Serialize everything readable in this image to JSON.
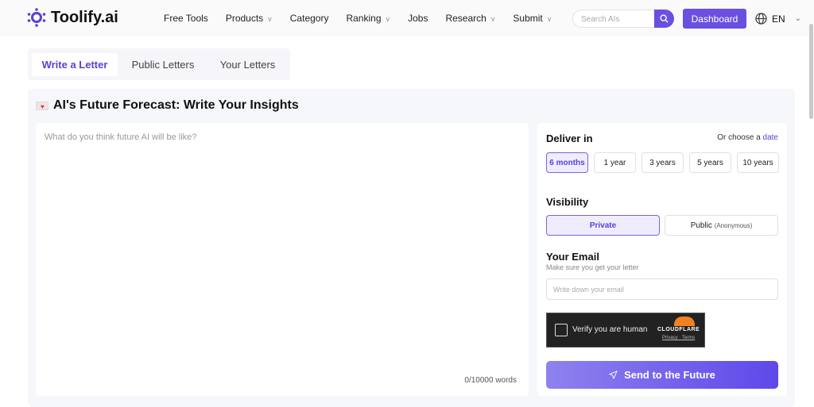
{
  "brand": {
    "name": "Toolify.ai",
    "accent": "#6b4fe0"
  },
  "nav": {
    "items": [
      {
        "label": "Free Tools",
        "dropdown": false
      },
      {
        "label": "Products",
        "dropdown": true
      },
      {
        "label": "Category",
        "dropdown": false
      },
      {
        "label": "Ranking",
        "dropdown": true
      },
      {
        "label": "Jobs",
        "dropdown": false
      },
      {
        "label": "Research",
        "dropdown": true
      },
      {
        "label": "Submit",
        "dropdown": true
      }
    ],
    "search_placeholder": "Search AIs",
    "dashboard": "Dashboard",
    "lang": "EN"
  },
  "tabs": [
    "Write a Letter",
    "Public Letters",
    "Your Letters"
  ],
  "title": "AI's Future Forecast: Write Your Insights",
  "editor": {
    "placeholder": "What do you think future AI will be like?",
    "count": "0/10000 words"
  },
  "deliver": {
    "label": "Deliver in",
    "alt_prefix": "Or choose a",
    "alt_link": "date",
    "options": [
      "6 months",
      "1 year",
      "3 years",
      "5 years",
      "10 years"
    ],
    "selected": 0
  },
  "visibility": {
    "label": "Visibility",
    "private": "Private",
    "public": "Public",
    "public_note": "(Anonymous)"
  },
  "email": {
    "label": "Your Email",
    "hint": "Make sure you get your letter",
    "placeholder": "Write down your email"
  },
  "captcha": {
    "label": "Verify you are human",
    "brand": "CLOUDFLARE",
    "privacy": "Privacy",
    "terms": "Terms"
  },
  "send": "Send to the Future"
}
